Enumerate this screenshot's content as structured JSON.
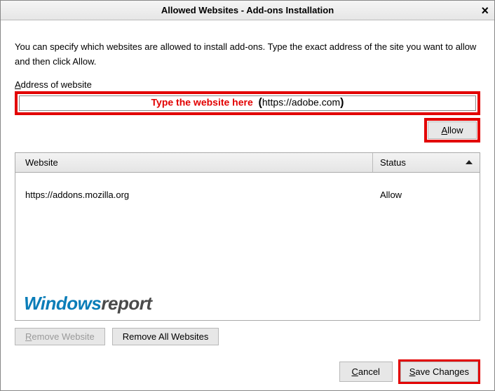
{
  "titlebar": {
    "title": "Allowed Websites - Add-ons Installation",
    "close_label": "×"
  },
  "instructions": "You can specify which websites are allowed to install add-ons. Type the exact address of the site you want to allow and then click Allow.",
  "address": {
    "label_pre": "A",
    "label_rest": "ddress of website",
    "overlay_red": "Type the website here",
    "overlay_paren_open": "(",
    "overlay_url": "https://adobe.com",
    "overlay_paren_close": ")"
  },
  "buttons": {
    "allow_pre": "A",
    "allow_rest": "llow",
    "remove_website_pre": "R",
    "remove_website_rest": "emove Website",
    "remove_all_pre": "R",
    "remove_all_rest": "emove All Websites",
    "cancel_pre": "C",
    "cancel_rest": "ancel",
    "save_pre": "S",
    "save_rest": "ave Changes"
  },
  "table": {
    "col_website": "Website",
    "col_status": "Status",
    "rows": [
      {
        "website": "https://addons.mozilla.org",
        "status": "Allow"
      }
    ]
  },
  "watermark": {
    "part1": "Windows",
    "part2": "report"
  }
}
